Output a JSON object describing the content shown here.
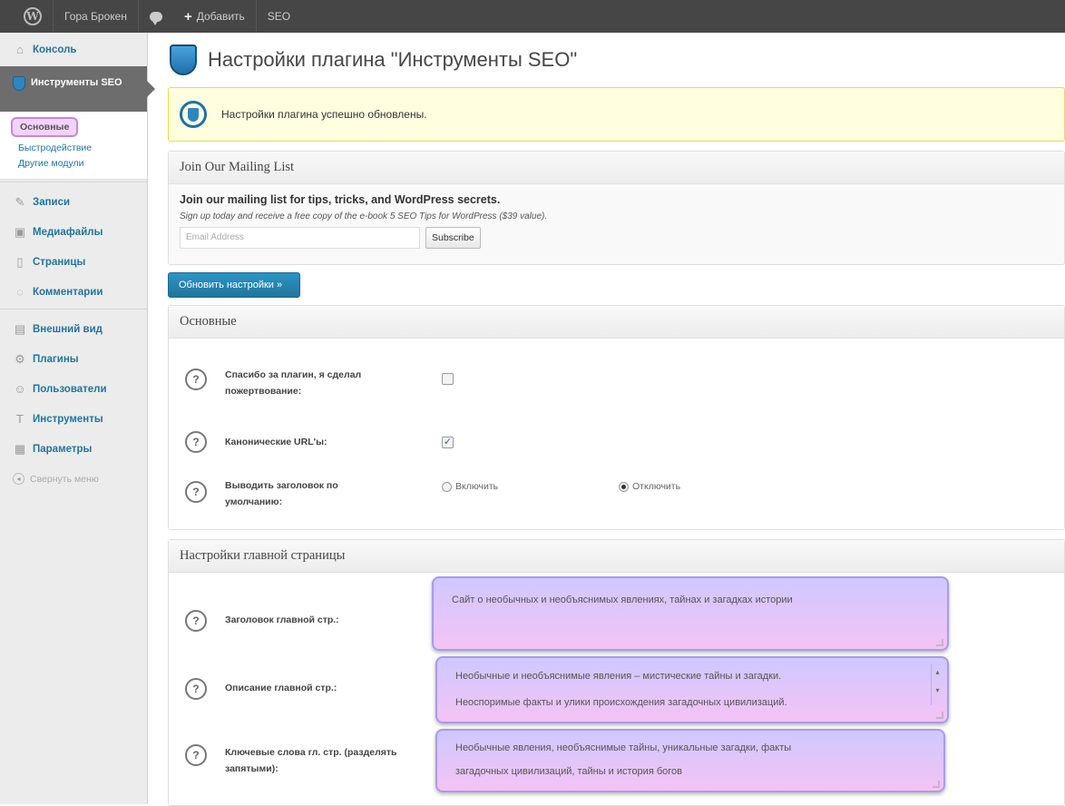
{
  "adminbar": {
    "site_name": "Гора Брокен",
    "add_new": "Добавить",
    "seo": "SEO"
  },
  "sidebar": {
    "console": "Консоль",
    "seo_tools": "Инструменты SEO",
    "submenu": [
      "Основные",
      "Быстродействие",
      "Другие модули"
    ],
    "posts": "Записи",
    "media": "Медиафайлы",
    "pages": "Страницы",
    "comments": "Комментарии",
    "appearance": "Внешний вид",
    "plugins": "Плагины",
    "users": "Пользователи",
    "tools": "Инструменты",
    "settings": "Параметры",
    "collapse": "Свернуть меню"
  },
  "page": {
    "title": "Настройки плагина \"Инструменты SEO\"",
    "notice": "Настройки плагина успешно обновлены."
  },
  "mailing": {
    "heading": "Join Our Mailing List",
    "title": "Join our mailing list for tips, tricks, and WordPress secrets.",
    "subtitle": "Sign up today and receive a free copy of the e-book 5 SEO Tips for WordPress ($39 value).",
    "email_placeholder": "Email Address",
    "subscribe": "Subscribe"
  },
  "save_button": "Обновить настройки »",
  "basic": {
    "heading": "Основные",
    "donated_label": "Спасибо за плагин, я сделал пожертвование:",
    "donated_checked": false,
    "canonical_label": "Канонические URL'ы:",
    "canonical_checked": true,
    "default_title_label": "Выводить заголовок по умолчанию:",
    "enable": "Включить",
    "disable": "Отключить",
    "default_title_value": "Отключить"
  },
  "home": {
    "heading": "Настройки главной страницы",
    "title_label": "Заголовок главной стр.:",
    "title_value": "Сайт о необычных и необъяснимых явлениях, тайнах и загадках истории",
    "desc_label": "Описание главной стр.:",
    "desc_line1": "Необычные и необъяснимые явления – мистические тайны и загадки.",
    "desc_line2": "Неоспоримые факты и улики происхождения загадочных цивилизаций.",
    "keywords_label": "Ключевые слова гл. стр. (разделять запятыми):",
    "keywords_line1": "Необычные явления, необъяснимые тайны, уникальные загадки, факты",
    "keywords_line2": "загадочных цивилизаций, тайны и история богов"
  },
  "colors": {
    "adminbar": "#464646",
    "link": "#21759b",
    "primary_button": "#21759b",
    "notice_bg": "#ffffe0",
    "highlight": "#f4c3f4"
  }
}
